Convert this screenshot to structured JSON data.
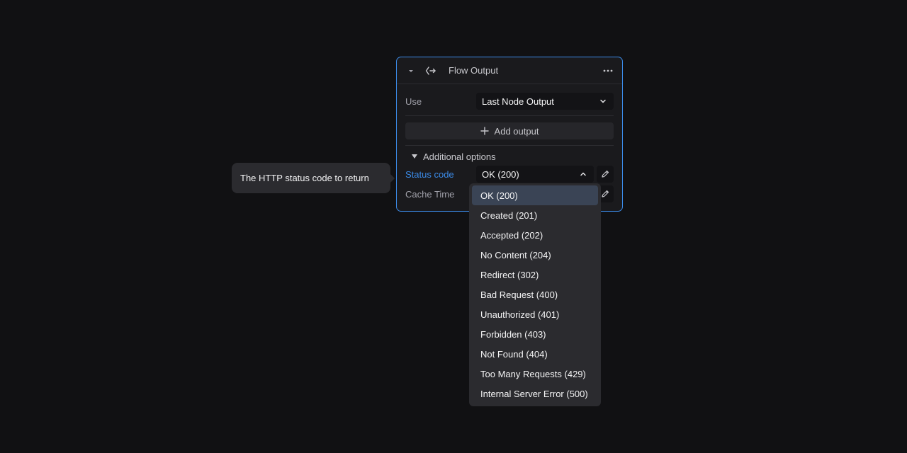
{
  "node": {
    "title": "Flow Output",
    "use_label": "Use",
    "use_value": "Last Node Output",
    "add_output_label": "Add output",
    "additional_options_label": "Additional options",
    "status_code_label": "Status code",
    "status_code_value": "OK (200)",
    "cache_time_label": "Cache Time"
  },
  "tooltip": {
    "text": "The HTTP status code to return"
  },
  "dropdown": {
    "options": [
      "OK (200)",
      "Created (201)",
      "Accepted (202)",
      "No Content (204)",
      "Redirect (302)",
      "Bad Request (400)",
      "Unauthorized (401)",
      "Forbidden (403)",
      "Not Found (404)",
      "Too Many Requests (429)",
      "Internal Server Error (500)"
    ],
    "selected": "OK (200)"
  },
  "colors": {
    "accent": "#3b8be8",
    "background": "#111113",
    "panel": "#1a1a1d",
    "dropdown": "#2b2b2f",
    "selected": "#3a4455"
  }
}
